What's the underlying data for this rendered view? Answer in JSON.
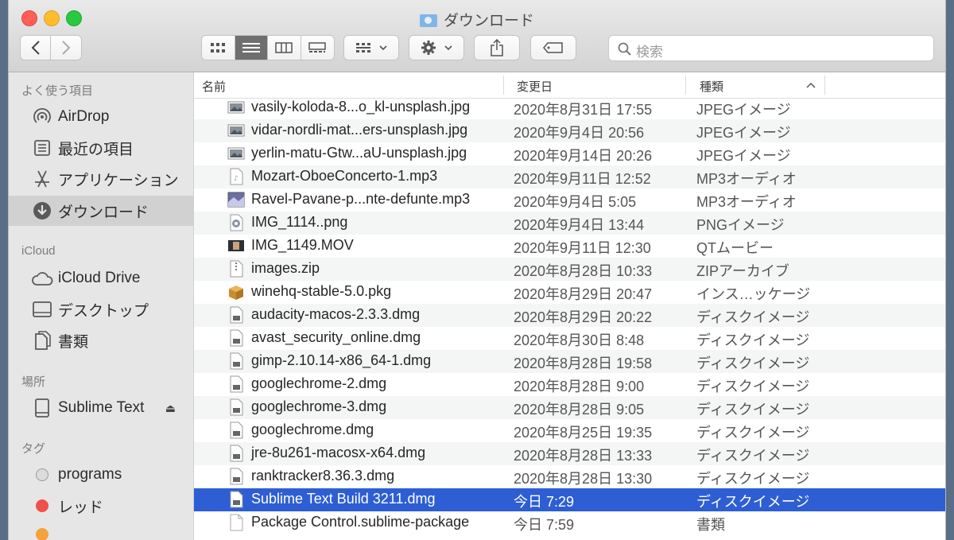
{
  "window": {
    "title": "ダウンロード"
  },
  "toolbar": {
    "search_placeholder": "検索"
  },
  "sidebar": {
    "favorites_header": "よく使う項目",
    "favorites": [
      {
        "label": "AirDrop",
        "icon": "airdrop-icon"
      },
      {
        "label": "最近の項目",
        "icon": "recents-icon"
      },
      {
        "label": "アプリケーション",
        "icon": "applications-icon"
      },
      {
        "label": "ダウンロード",
        "icon": "downloads-icon",
        "selected": true
      }
    ],
    "icloud_header": "iCloud",
    "icloud": [
      {
        "label": "iCloud Drive",
        "icon": "cloud-icon"
      },
      {
        "label": "デスクトップ",
        "icon": "desktop-icon"
      },
      {
        "label": "書類",
        "icon": "documents-icon"
      }
    ],
    "locations_header": "場所",
    "locations": [
      {
        "label": "Sublime Text",
        "icon": "drive-icon",
        "eject": "⏏"
      }
    ],
    "tags_header": "タグ",
    "tags": [
      {
        "label": "programs",
        "color": "#c8c8c8"
      },
      {
        "label": "レッド",
        "color": "#f0504a"
      }
    ]
  },
  "columns": {
    "name": "名前",
    "date": "変更日",
    "kind": "種類"
  },
  "files": [
    {
      "name": "vasily-koloda-8...o_kl-unsplash.jpg",
      "date": "2020年8月31日 17:55",
      "kind": "JPEGイメージ",
      "icon": "image-thumb-icon"
    },
    {
      "name": "vidar-nordli-mat...ers-unsplash.jpg",
      "date": "2020年9月4日 20:56",
      "kind": "JPEGイメージ",
      "icon": "image-thumb-icon"
    },
    {
      "name": "yerlin-matu-Gtw...aU-unsplash.jpg",
      "date": "2020年9月14日 20:26",
      "kind": "JPEGイメージ",
      "icon": "image-thumb-icon"
    },
    {
      "name": "Mozart-OboeConcerto-1.mp3",
      "date": "2020年9月11日 12:52",
      "kind": "MP3オーディオ",
      "icon": "audio-file-icon"
    },
    {
      "name": "Ravel-Pavane-p...nte-defunte.mp3",
      "date": "2020年9月4日 5:05",
      "kind": "MP3オーディオ",
      "icon": "audio-art-icon"
    },
    {
      "name": "IMG_1114..png",
      "date": "2020年9月4日 13:44",
      "kind": "PNGイメージ",
      "icon": "png-file-icon"
    },
    {
      "name": "IMG_1149.MOV",
      "date": "2020年9月11日 12:30",
      "kind": "QTムービー",
      "icon": "movie-thumb-icon"
    },
    {
      "name": "images.zip",
      "date": "2020年8月28日 10:33",
      "kind": "ZIPアーカイブ",
      "icon": "zip-file-icon"
    },
    {
      "name": "winehq-stable-5.0.pkg",
      "date": "2020年8月29日 20:47",
      "kind": "インス…ッケージ",
      "icon": "package-icon"
    },
    {
      "name": "audacity-macos-2.3.3.dmg",
      "date": "2020年8月29日 20:22",
      "kind": "ディスクイメージ",
      "icon": "disk-image-icon"
    },
    {
      "name": "avast_security_online.dmg",
      "date": "2020年8月30日 8:48",
      "kind": "ディスクイメージ",
      "icon": "disk-image-icon"
    },
    {
      "name": "gimp-2.10.14-x86_64-1.dmg",
      "date": "2020年8月28日 19:58",
      "kind": "ディスクイメージ",
      "icon": "disk-image-icon"
    },
    {
      "name": "googlechrome-2.dmg",
      "date": "2020年8月28日 9:00",
      "kind": "ディスクイメージ",
      "icon": "disk-image-icon"
    },
    {
      "name": "googlechrome-3.dmg",
      "date": "2020年8月28日 9:05",
      "kind": "ディスクイメージ",
      "icon": "disk-image-icon"
    },
    {
      "name": "googlechrome.dmg",
      "date": "2020年8月25日 19:35",
      "kind": "ディスクイメージ",
      "icon": "disk-image-icon"
    },
    {
      "name": "jre-8u261-macosx-x64.dmg",
      "date": "2020年8月28日 13:33",
      "kind": "ディスクイメージ",
      "icon": "disk-image-icon"
    },
    {
      "name": "ranktracker8.36.3.dmg",
      "date": "2020年8月28日 13:30",
      "kind": "ディスクイメージ",
      "icon": "disk-image-icon"
    },
    {
      "name": "Sublime Text Build 3211.dmg",
      "date": "今日 7:29",
      "kind": "ディスクイメージ",
      "icon": "disk-image-icon",
      "selected": true
    },
    {
      "name": "Package Control.sublime-package",
      "date": "今日 7:59",
      "kind": "書類",
      "icon": "document-icon"
    }
  ],
  "colors": {
    "selection": "#2e5ed3",
    "accent": "#2e5ed3"
  }
}
